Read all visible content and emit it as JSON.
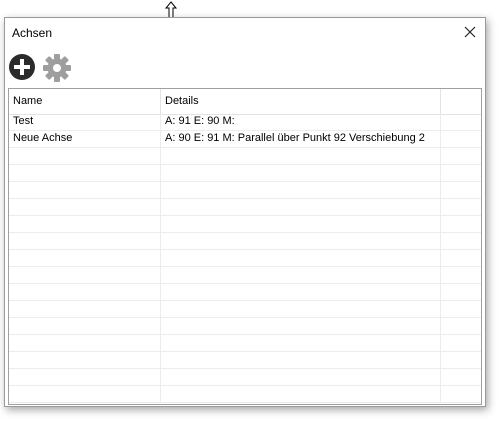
{
  "window": {
    "title": "Achsen",
    "close_icon": "close-icon"
  },
  "toolbar": {
    "add_icon": "plus-circle-icon",
    "settings_icon": "gear-icon"
  },
  "grid": {
    "columns": [
      "Name",
      "Details"
    ],
    "rows": [
      {
        "name": "Test",
        "details": "A: 91 E: 90 M:"
      },
      {
        "name": "Neue Achse",
        "details": "A: 90 E: 91 M: Parallel über Punkt 92 Verschiebung 2"
      }
    ]
  },
  "colors": {
    "add_icon": "#2b2b2b",
    "settings_icon": "#9e9e9e"
  }
}
